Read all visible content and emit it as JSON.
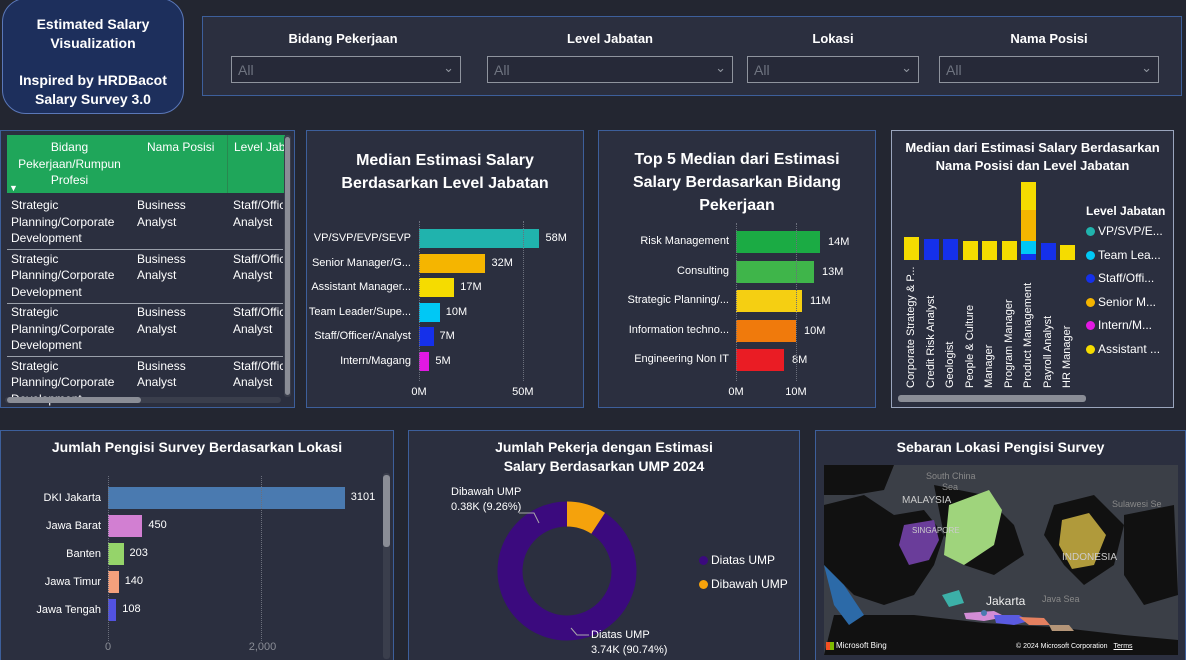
{
  "header": {
    "title_line1": "Estimated Salary",
    "title_line2": "Visualization",
    "title_line3": "Inspired by HRDBacot",
    "title_line4": "Salary Survey 3.0"
  },
  "filters": [
    {
      "label": "Bidang Pekerjaan",
      "value": "All"
    },
    {
      "label": "Level Jabatan",
      "value": "All"
    },
    {
      "label": "Lokasi",
      "value": "All"
    },
    {
      "label": "Nama Posisi",
      "value": "All"
    }
  ],
  "table": {
    "columns": [
      "Bidang Pekerjaan/Rumpun Profesi",
      "Nama Posisi",
      "Level Jab"
    ],
    "col1_lines": [
      "Bidang",
      "Pekerjaan/Rumpun",
      "Profesi"
    ],
    "rows": [
      {
        "c1": [
          "Strategic",
          "Planning/Corporate",
          "Development"
        ],
        "c2": [
          "Business",
          "Analyst"
        ],
        "c3": [
          "Staff/Offic",
          "Analyst"
        ]
      },
      {
        "c1": [
          "Strategic",
          "Planning/Corporate",
          "Development"
        ],
        "c2": [
          "Business",
          "Analyst"
        ],
        "c3": [
          "Staff/Offic",
          "Analyst"
        ]
      },
      {
        "c1": [
          "Strategic",
          "Planning/Corporate",
          "Development"
        ],
        "c2": [
          "Business",
          "Analyst"
        ],
        "c3": [
          "Staff/Offic",
          "Analyst"
        ]
      },
      {
        "c1": [
          "Strategic",
          "Planning/Corporate",
          "Development"
        ],
        "c2": [
          "Business",
          "Analyst"
        ],
        "c3": [
          "Staff/Offic",
          "Analyst"
        ]
      }
    ]
  },
  "chart_data": [
    {
      "type": "bar",
      "orientation": "horizontal",
      "title_line1": "Median Estimasi Salary",
      "title_line2": "Berdasarkan Level Jabatan",
      "categories": [
        "VP/SVP/EVP/SEVP",
        "Senior Manager/G...",
        "Assistant Manager...",
        "Team Leader/Supe...",
        "Staff/Officer/Analyst",
        "Intern/Magang"
      ],
      "values": [
        58,
        32,
        17,
        10,
        7,
        5
      ],
      "value_labels": [
        "58M",
        "32M",
        "17M",
        "10M",
        "7M",
        "5M"
      ],
      "colors": [
        "#20b3ad",
        "#f5b500",
        "#f5dc00",
        "#00c8f5",
        "#1530ea",
        "#e218e3"
      ],
      "xticks": [
        "0M",
        "50M"
      ],
      "xlim": [
        0,
        65
      ]
    },
    {
      "type": "bar",
      "orientation": "horizontal",
      "title_line1": "Top 5 Median dari Estimasi",
      "title_line2": "Salary Berdasarkan Bidang",
      "title_line3": "Pekerjaan",
      "categories": [
        "Risk Management",
        "Consulting",
        "Strategic Planning/...",
        "Information techno...",
        "Engineering Non IT"
      ],
      "values": [
        14,
        13,
        11,
        10,
        8
      ],
      "value_labels": [
        "14M",
        "13M",
        "11M",
        "10M",
        "8M"
      ],
      "colors": [
        "#1bab44",
        "#3fb54a",
        "#f5cf12",
        "#f07a0c",
        "#ea1c24"
      ],
      "xticks": [
        "0M",
        "10M"
      ],
      "xlim": [
        0,
        16
      ]
    },
    {
      "type": "bar",
      "orientation": "vertical-stacked",
      "title_line1": "Median dari Estimasi Salary Berdasarkan",
      "title_line2": "Nama Posisi dan Level Jabatan",
      "categories": [
        "Corporate Strategy & P...",
        "Credit Risk Analyst",
        "Geologist",
        "People & Culture",
        "Manager",
        "Program Manager",
        "Product Management",
        "Payroll Analyst",
        "HR Manager"
      ],
      "legend_title": "Level Jabatan",
      "legend": [
        {
          "name": "VP/SVP/E...",
          "color": "#20b3ad"
        },
        {
          "name": "Team Lea...",
          "color": "#00c8f5"
        },
        {
          "name": "Staff/Offi...",
          "color": "#1530ea"
        },
        {
          "name": "Senior M...",
          "color": "#f5b500"
        },
        {
          "name": "Intern/M...",
          "color": "#e218e3"
        },
        {
          "name": "Assistant ...",
          "color": "#f5dc00"
        }
      ],
      "bars": [
        {
          "segments": [
            {
              "color": "#f5dc00",
              "value": 22
            }
          ]
        },
        {
          "segments": [
            {
              "color": "#1530ea",
              "value": 20
            }
          ]
        },
        {
          "segments": [
            {
              "color": "#1530ea",
              "value": 20
            }
          ]
        },
        {
          "segments": [
            {
              "color": "#f5dc00",
              "value": 18
            }
          ]
        },
        {
          "segments": [
            {
              "color": "#f5dc00",
              "value": 18
            }
          ]
        },
        {
          "segments": [
            {
              "color": "#f5dc00",
              "value": 18
            }
          ]
        },
        {
          "segments": [
            {
              "color": "#1530ea",
              "value": 6
            },
            {
              "color": "#00c8f5",
              "value": 12
            },
            {
              "color": "#f5b500",
              "value": 30
            },
            {
              "color": "#f5dc00",
              "value": 26
            }
          ]
        },
        {
          "segments": [
            {
              "color": "#1530ea",
              "value": 16
            }
          ]
        },
        {
          "segments": [
            {
              "color": "#f5dc00",
              "value": 14
            }
          ]
        }
      ]
    },
    {
      "type": "bar",
      "orientation": "horizontal",
      "title": "Jumlah Pengisi Survey Berdasarkan Lokasi",
      "categories": [
        "DKI Jakarta",
        "Jawa Barat",
        "Banten",
        "Jawa Timur",
        "Jawa Tengah"
      ],
      "values": [
        3101,
        450,
        203,
        140,
        108
      ],
      "value_labels": [
        "3101",
        "450",
        "203",
        "140",
        "108"
      ],
      "colors": [
        "#4a7ab0",
        "#d27fd2",
        "#95d46a",
        "#f4a07c",
        "#5252e0"
      ],
      "xticks": [
        "0",
        "2,000"
      ],
      "xlim": [
        0,
        3300
      ]
    },
    {
      "type": "pie",
      "donut": true,
      "title_line1": "Jumlah Pekerja dengan Estimasi",
      "title_line2": "Salary Berdasarkan UMP 2024",
      "slices": [
        {
          "name": "Diatas UMP",
          "value": 3.74,
          "label_line1": "Diatas UMP",
          "label_line2": "3.74K (90.74%)",
          "color": "#3b0a7e"
        },
        {
          "name": "Dibawah UMP",
          "value": 0.38,
          "label_line1": "Dibawah UMP",
          "label_line2": "0.38K (9.26%)",
          "color": "#f5a20c"
        }
      ],
      "legend": [
        "Diatas UMP",
        "Dibawah UMP"
      ]
    }
  ],
  "map": {
    "title": "Sebaran Lokasi Pengisi Survey",
    "labels": {
      "south_china": "South China",
      "sea": "Sea",
      "malaysia": "MALAYSIA",
      "singapore": "SINGAPORE",
      "sulawesi_sea": "Sulawesi Se",
      "indonesia": "INDONESIA",
      "jakarta": "Jakarta",
      "java_sea": "Java Sea",
      "bing": "Microsoft Bing",
      "copyright": "© 2024 Microsoft Corporation",
      "terms": "Terms"
    }
  }
}
